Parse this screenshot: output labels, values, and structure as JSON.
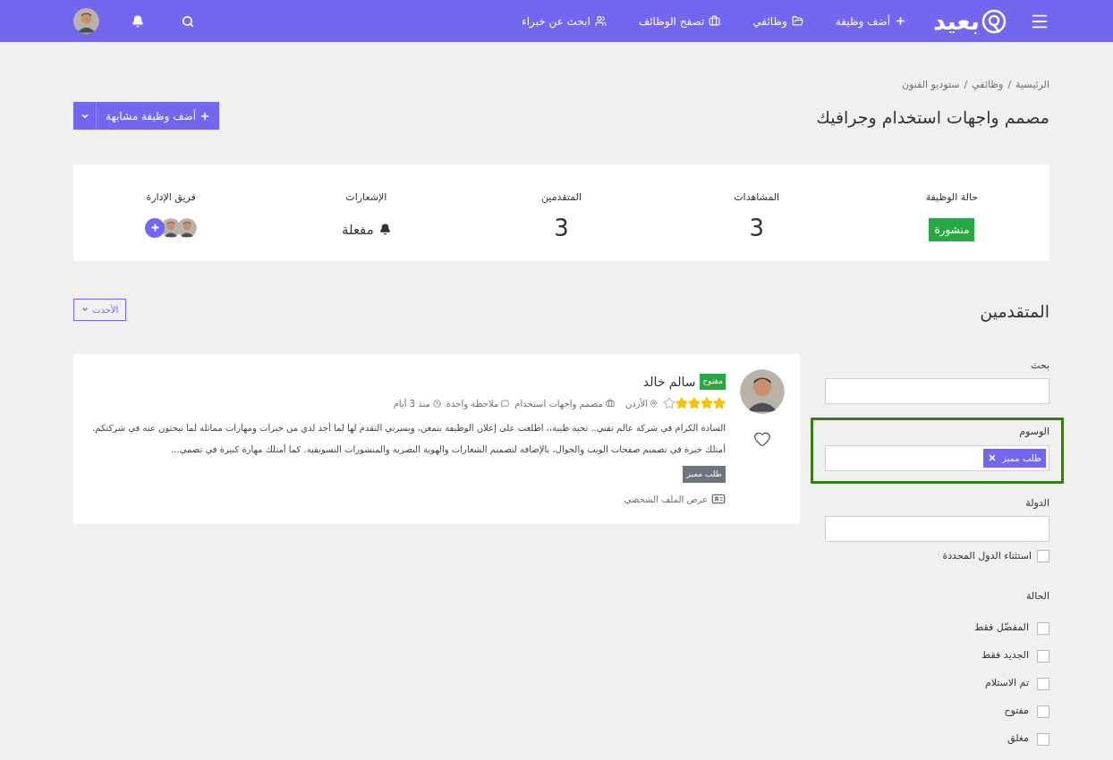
{
  "navbar": {
    "logo": "بعيد",
    "links": [
      {
        "label": "أضف وظيفة",
        "kind": "add"
      },
      {
        "label": "وظائفي",
        "kind": "mine"
      },
      {
        "label": "تصفح الوظائف",
        "kind": "browse"
      },
      {
        "label": "ابحث عن خبراء",
        "kind": "experts"
      }
    ]
  },
  "breadcrumbs": [
    "الرئيسية",
    "وظائفي",
    "ستوديو الفنون"
  ],
  "breadcrumb_separator": "/",
  "title": "مصمم واجهات استخدام وجرافيك",
  "add_similar_button": "أضف وظيفة مشابهة",
  "stats": [
    {
      "kind": "badge",
      "label": "حالة الوظيفة",
      "value": "منشورة"
    },
    {
      "kind": "number",
      "label": "المشاهدات",
      "value": "3"
    },
    {
      "kind": "number",
      "label": "المتقدمين",
      "value": "3"
    },
    {
      "kind": "bell",
      "label": "الإشعارات",
      "value": "مفعلة"
    },
    {
      "kind": "team",
      "label": "فريق الإدارة"
    }
  ],
  "applicants_heading": "المتقدمين",
  "sort_button": "الأحدث",
  "filters": {
    "fields": [
      {
        "label": "بحث",
        "highlighted": false
      },
      {
        "label": "الوسوم",
        "highlighted": true,
        "tags": [
          "طلب مميز"
        ]
      },
      {
        "label": "الدولة",
        "highlighted": false
      }
    ],
    "exclude_countries": {
      "label": "استثناء الدول المحددة",
      "checked": false
    },
    "status_heading": "الحالة",
    "statuses": [
      {
        "label": "المفضّل فقط",
        "checked": false
      },
      {
        "label": "الجديد فقط",
        "checked": false
      },
      {
        "label": "تم الاستلام",
        "checked": false
      },
      {
        "label": "مفتوح",
        "checked": false
      },
      {
        "label": "مغلق",
        "checked": false
      }
    ]
  },
  "applicants": [
    {
      "name": "سالم خالد",
      "status": "مفتوح",
      "stars": 4,
      "country": "الأردن",
      "job": "مصمم واجهات استخدام",
      "notes": "ملاحظة واحدة",
      "time": "منذ 3 أيام",
      "favorite": false,
      "letter": "السادة الكرام في شركة عالم تقني.. تحية طيبة،، اطلعت على إعلان الوظيفة بتمعن، ويسرني التقدم لها لما أجد لدي من خبرات ومهارات مماثلة لما تبحثون عنه في شركتكم. أمتلك خبرة في تصميم صفحات الويب والجوال، بالإضافة لتصميم الشعارات والهوية البصرية والمنشورات التسويقية. كما أمتلك مهارة كبيرة في تصمي...",
      "tags": [
        "طلب مميز"
      ],
      "profile_link": "عرض الملف الشخصي"
    }
  ]
}
